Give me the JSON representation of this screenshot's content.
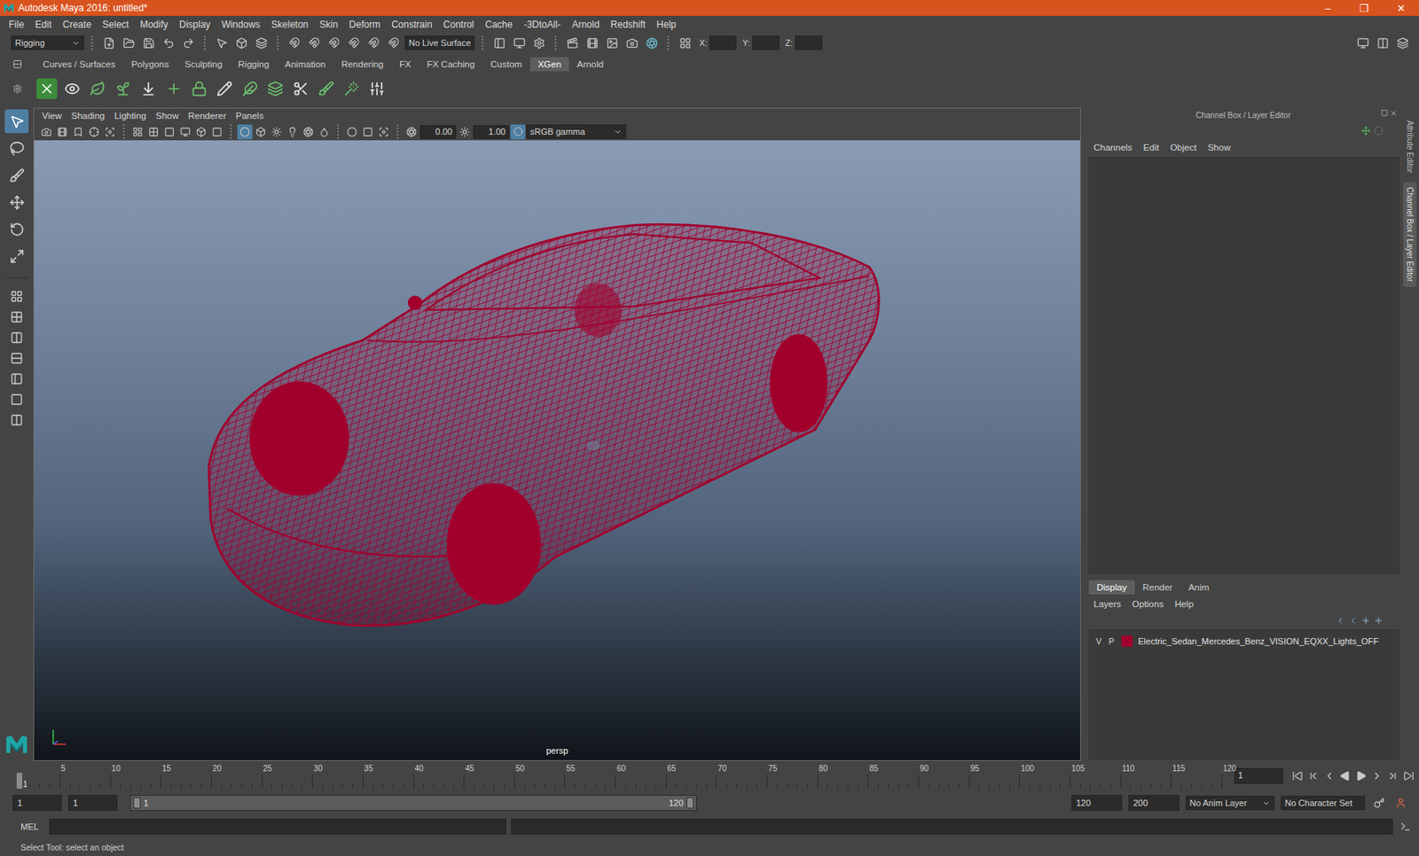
{
  "window": {
    "title": "Autodesk Maya 2016: untitled*",
    "controls": [
      "–",
      "❐",
      "✕"
    ]
  },
  "menu_bar": [
    "File",
    "Edit",
    "Create",
    "Select",
    "Modify",
    "Display",
    "Windows",
    "Skeleton",
    "Skin",
    "Deform",
    "Constrain",
    "Control",
    "Cache",
    "-3DtoAll-",
    "Arnold",
    "Redshift",
    "Help"
  ],
  "status_line": {
    "menu_set": "Rigging",
    "live_surface": "No Live Surface",
    "coords": [
      "X:",
      "Y:",
      "Z:"
    ]
  },
  "shelf": {
    "tabs": [
      {
        "label": "Curves / Surfaces",
        "selected": false
      },
      {
        "label": "Polygons",
        "selected": false
      },
      {
        "label": "Sculpting",
        "selected": false
      },
      {
        "label": "Rigging",
        "selected": false
      },
      {
        "label": "Animation",
        "selected": false
      },
      {
        "label": "Rendering",
        "selected": false
      },
      {
        "label": "FX",
        "selected": false
      },
      {
        "label": "FX Caching",
        "selected": false
      },
      {
        "label": "Custom",
        "selected": false
      },
      {
        "label": "XGen",
        "selected": true
      },
      {
        "label": "Arnold",
        "selected": false
      }
    ]
  },
  "toolbox": {
    "tools": [
      {
        "kind": "select",
        "selected": true
      },
      {
        "kind": "lasso",
        "selected": false
      },
      {
        "kind": "paint",
        "selected": false
      },
      {
        "kind": "move",
        "selected": false
      },
      {
        "kind": "rotate",
        "selected": false
      },
      {
        "kind": "scale",
        "selected": false
      }
    ]
  },
  "viewport": {
    "menu": [
      "View",
      "Shading",
      "Lighting",
      "Show",
      "Renderer",
      "Panels"
    ],
    "exposure": "0.00",
    "gamma": "1.00",
    "color_space": "sRGB gamma",
    "camera": "persp"
  },
  "channel_box": {
    "title": "Channel Box / Layer Editor",
    "menu": [
      "Channels",
      "Edit",
      "Object",
      "Show"
    ]
  },
  "layer_editor": {
    "tabs": [
      {
        "label": "Display",
        "selected": true
      },
      {
        "label": "Render",
        "selected": false
      },
      {
        "label": "Anim",
        "selected": false
      }
    ],
    "menu": [
      "Layers",
      "Options",
      "Help"
    ],
    "layers": [
      {
        "visible": "V",
        "playback": "P",
        "name": "Electric_Sedan_Mercedes_Benz_VISION_EQXX_Lights_OFF",
        "color": "#a1002d"
      }
    ]
  },
  "side_tabs": [
    {
      "label": "Attribute Editor",
      "selected": false
    },
    {
      "label": "Channel Box / Layer Editor",
      "selected": true
    }
  ],
  "time_slider": {
    "start": "1",
    "ticks": [
      "5",
      "10",
      "15",
      "20",
      "25",
      "30",
      "35",
      "40",
      "45",
      "50",
      "55",
      "60",
      "65",
      "70",
      "75",
      "80",
      "85",
      "90",
      "95",
      "100",
      "105",
      "110",
      "115",
      "120"
    ],
    "current_frame": "1"
  },
  "range_slider": {
    "start": "1",
    "playback_start": "1",
    "range_start": "1",
    "range_end": "120",
    "playback_end": "120",
    "end": "200",
    "anim_layer": "No Anim Layer",
    "character_set": "No Character Set"
  },
  "command_line": {
    "language": "MEL"
  },
  "help_line": "Select Tool: select an object"
}
